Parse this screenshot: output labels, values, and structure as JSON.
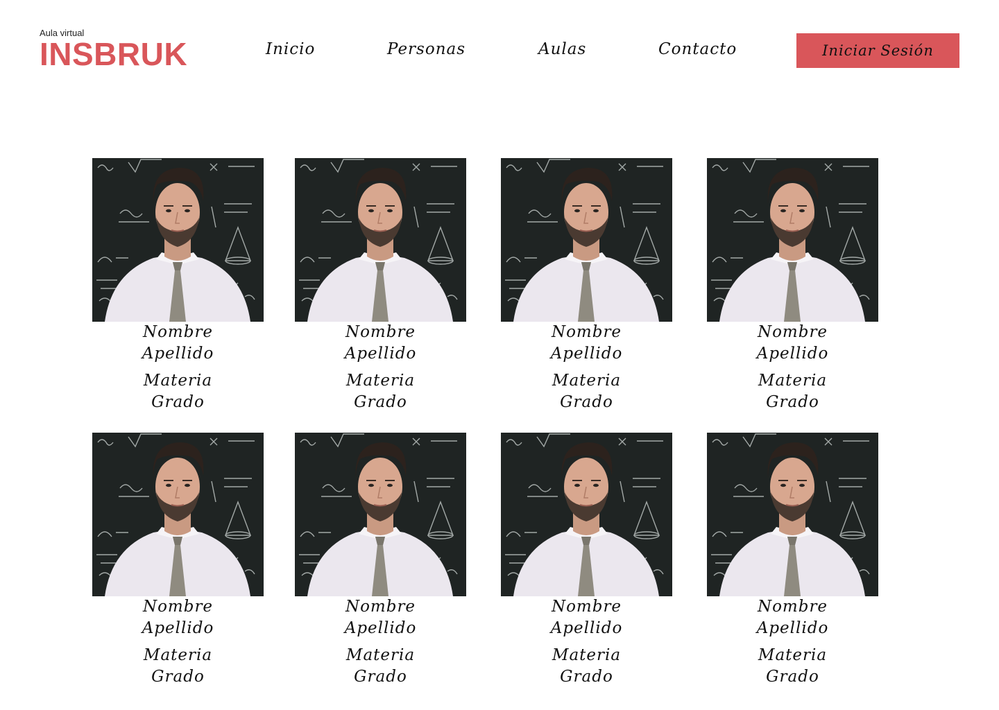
{
  "brand": {
    "subtitle": "Aula virtual",
    "name": "INSBRUK"
  },
  "nav": {
    "items": [
      {
        "label": "Inicio"
      },
      {
        "label": "Personas"
      },
      {
        "label": "Aulas"
      },
      {
        "label": "Contacto"
      }
    ],
    "login_label": "Iniciar Sesión"
  },
  "colors": {
    "accent": "#d9565a",
    "chalkboard": "#1f2423"
  },
  "people": [
    {
      "nombre": "Nombre",
      "apellido": "Apellido",
      "materia": "Materia",
      "grado": "Grado"
    },
    {
      "nombre": "Nombre",
      "apellido": "Apellido",
      "materia": "Materia",
      "grado": "Grado"
    },
    {
      "nombre": "Nombre",
      "apellido": "Apellido",
      "materia": "Materia",
      "grado": "Grado"
    },
    {
      "nombre": "Nombre",
      "apellido": "Apellido",
      "materia": "Materia",
      "grado": "Grado"
    },
    {
      "nombre": "Nombre",
      "apellido": "Apellido",
      "materia": "Materia",
      "grado": "Grado"
    },
    {
      "nombre": "Nombre",
      "apellido": "Apellido",
      "materia": "Materia",
      "grado": "Grado"
    },
    {
      "nombre": "Nombre",
      "apellido": "Apellido",
      "materia": "Materia",
      "grado": "Grado"
    },
    {
      "nombre": "Nombre",
      "apellido": "Apellido",
      "materia": "Materia",
      "grado": "Grado"
    }
  ]
}
